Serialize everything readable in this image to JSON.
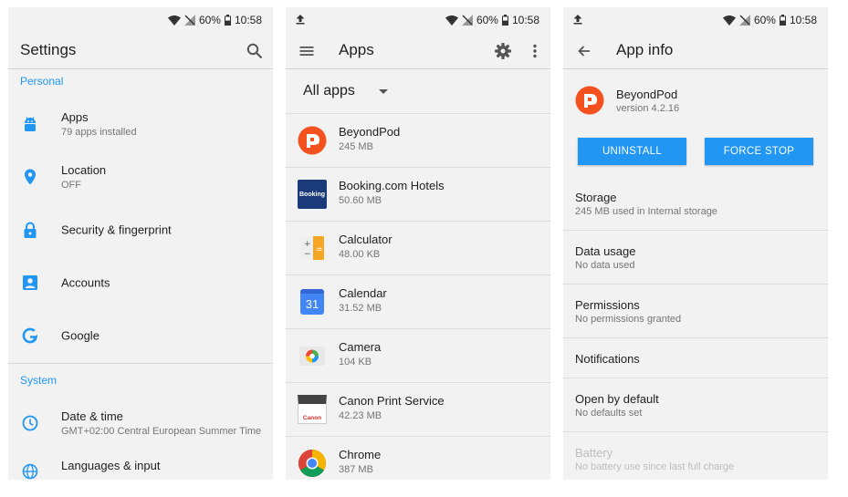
{
  "status": {
    "battery": "60%",
    "time": "10:58"
  },
  "settings": {
    "title": "Settings",
    "section_personal": "Personal",
    "section_system": "System",
    "items": [
      {
        "label": "Apps",
        "sub": "79 apps installed",
        "icon": "android-icon"
      },
      {
        "label": "Location",
        "sub": "OFF",
        "icon": "location-pin-icon"
      },
      {
        "label": "Security & fingerprint",
        "sub": "",
        "icon": "lock-icon"
      },
      {
        "label": "Accounts",
        "sub": "",
        "icon": "account-box-icon"
      },
      {
        "label": "Google",
        "sub": "",
        "icon": "google-icon"
      }
    ],
    "system_items": [
      {
        "label": "Date & time",
        "sub": "GMT+02:00 Central European Summer Time",
        "icon": "clock-icon"
      },
      {
        "label": "Languages & input",
        "sub": "",
        "icon": "globe-icon"
      }
    ]
  },
  "apps": {
    "title": "Apps",
    "filter": "All apps",
    "list": [
      {
        "name": "BeyondPod",
        "size": "245 MB"
      },
      {
        "name": "Booking.com Hotels",
        "size": "50.60 MB",
        "icon_text": "Booking"
      },
      {
        "name": "Calculator",
        "size": "48.00 KB"
      },
      {
        "name": "Calendar",
        "size": "31.52 MB",
        "icon_text": "31"
      },
      {
        "name": "Camera",
        "size": "104 KB"
      },
      {
        "name": "Canon Print Service",
        "size": "42.23 MB",
        "icon_text": "Canon"
      },
      {
        "name": "Chrome",
        "size": "387 MB"
      }
    ]
  },
  "app_info": {
    "title": "App info",
    "app_name": "BeyondPod",
    "version": "version 4.2.16",
    "uninstall": "UNINSTALL",
    "force_stop": "FORCE STOP",
    "rows": [
      {
        "title": "Storage",
        "sub": "245 MB used in Internal storage"
      },
      {
        "title": "Data usage",
        "sub": "No data used"
      },
      {
        "title": "Permissions",
        "sub": "No permissions granted"
      },
      {
        "title": "Notifications",
        "sub": ""
      },
      {
        "title": "Open by default",
        "sub": "No defaults set"
      },
      {
        "title": "Battery",
        "sub": "No battery use since last full charge"
      }
    ]
  },
  "colors": {
    "accent": "#2196f3",
    "beyondpod": "#f4511e",
    "booking": "#1b3a7a"
  }
}
